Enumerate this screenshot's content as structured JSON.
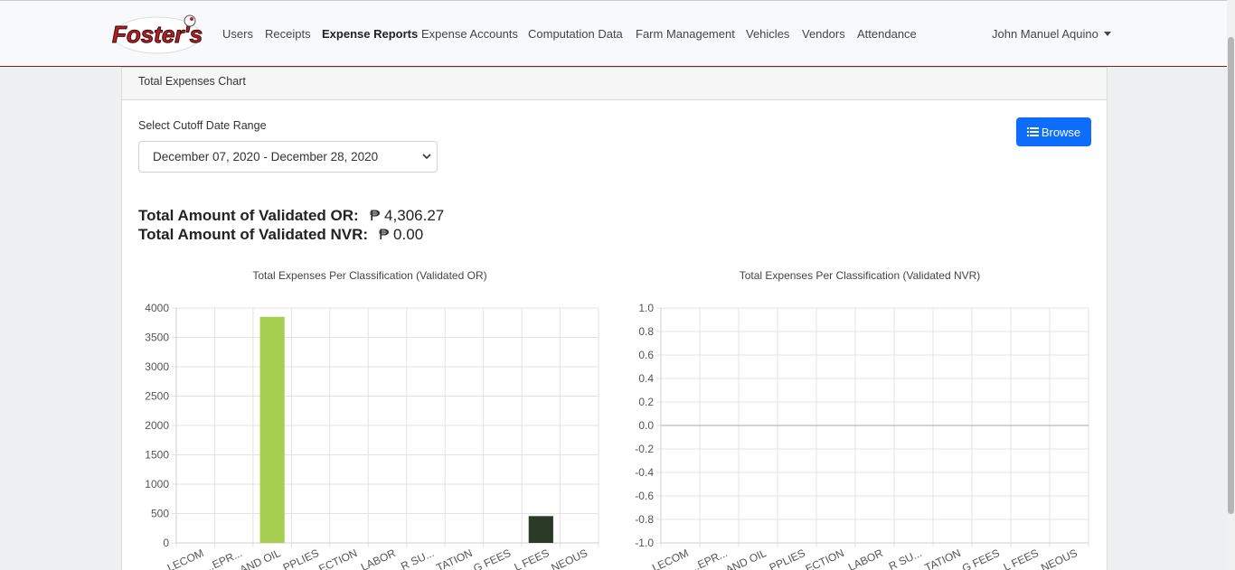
{
  "app": {
    "logo_text": "Foster's"
  },
  "nav": {
    "items": [
      {
        "label": "Users",
        "active": false
      },
      {
        "label": "Receipts",
        "active": false
      },
      {
        "label": "Expense Reports",
        "active": true
      },
      {
        "label": "Expense Accounts",
        "active": false
      },
      {
        "label": "Computation Data",
        "active": false
      },
      {
        "label": "Farm Management",
        "active": false
      },
      {
        "label": "Vehicles",
        "active": false
      },
      {
        "label": "Vendors",
        "active": false
      },
      {
        "label": "Attendance",
        "active": false
      }
    ],
    "user": "John Manuel Aquino"
  },
  "card": {
    "header": "Total Expenses Chart",
    "range_label": "Select Cutoff Date Range",
    "range_value": "December 07, 2020 - December 28, 2020",
    "browse_label": "Browse",
    "total_or_label": "Total Amount of Validated OR:",
    "total_or_value": "₱ 4,306.27",
    "total_nvr_label": "Total Amount of Validated NVR:",
    "total_nvr_value": "₱ 0.00"
  },
  "colors": {
    "accent": "#0d6efd",
    "brand": "#8b1c1c"
  },
  "chart_data": [
    {
      "type": "bar",
      "title": "Total Expenses Per Classification (Validated OR)",
      "categories": [
        "...LECOM",
        "...EPR...",
        "...AND OIL",
        "...PPLIES",
        "...ECTION",
        "...LABOR",
        "...R SU...",
        "...TATION",
        "...G FEES",
        "...L FEES",
        "...NEOUS"
      ],
      "values": [
        0,
        0,
        3850,
        0,
        0,
        0,
        0,
        0,
        0,
        456.27,
        0
      ],
      "colors": [
        "#cccccc",
        "#cccccc",
        "#a6ce50",
        "#cccccc",
        "#cccccc",
        "#cccccc",
        "#cccccc",
        "#cccccc",
        "#cccccc",
        "#2a3a26",
        "#cccccc"
      ],
      "ylim": [
        0,
        4000
      ],
      "yticks": [
        0,
        500,
        1000,
        1500,
        2000,
        2500,
        3000,
        3500,
        4000
      ],
      "grid": true
    },
    {
      "type": "bar",
      "title": "Total Expenses Per Classification (Validated NVR)",
      "categories": [
        "...LECOM",
        "...EPR...",
        "...AND OIL",
        "...PPLIES",
        "...ECTION",
        "...LABOR",
        "...R SU...",
        "...TATION",
        "...G FEES",
        "...L FEES",
        "...NEOUS"
      ],
      "values": [
        0,
        0,
        0,
        0,
        0,
        0,
        0,
        0,
        0,
        0,
        0
      ],
      "ylim": [
        -1.0,
        1.0
      ],
      "yticks": [
        -1.0,
        -0.8,
        -0.6,
        -0.4,
        -0.2,
        0,
        0.2,
        0.4,
        0.6,
        0.8,
        1.0
      ],
      "grid": true
    }
  ]
}
